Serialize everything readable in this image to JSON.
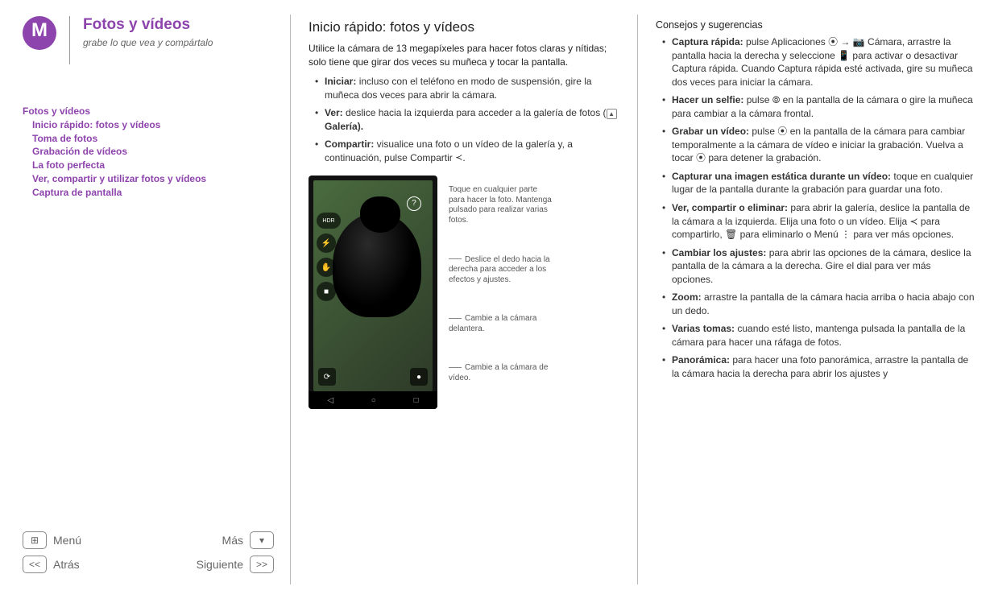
{
  "header": {
    "title": "Fotos y vídeos",
    "subtitle": "grabe lo que vea y compártalo"
  },
  "toc": {
    "root": "Fotos y vídeos",
    "items": [
      "Inicio rápido: fotos y vídeos",
      "Toma de fotos",
      "Grabación de vídeos",
      "La foto perfecta",
      "Ver, compartir y utilizar fotos y vídeos",
      "Captura de pantalla"
    ]
  },
  "nav": {
    "menu": "Menú",
    "mas": "Más",
    "atras": "Atrás",
    "siguiente": "Siguiente"
  },
  "main": {
    "title": "Inicio rápido: fotos y vídeos",
    "intro": "Utilice la cámara de 13 megapíxeles para hacer fotos claras y nítidas; solo tiene que girar dos veces su muñeca y tocar la pantalla.",
    "bullets": [
      {
        "label": "Iniciar:",
        "text": " incluso con el teléfono en modo de suspensión, gire la muñeca dos veces para abrir la cámara."
      },
      {
        "label": "Ver:",
        "text": " deslice hacia la izquierda para acceder a la galería de fotos (",
        "tail": " Galería)."
      },
      {
        "label": "Compartir:",
        "text": " visualice una foto o un vídeo de la galería y, a continuación, pulse Compartir ",
        "tail": "."
      }
    ],
    "callouts": {
      "c1": "Toque en cualquier parte para hacer la foto. Mantenga pulsado para realizar varias fotos.",
      "c2": "Deslice el dedo hacia la derecha para acceder a los efectos y ajustes.",
      "c3": "Cambie a la cámara delantera.",
      "c4": "Cambie a la cámara de vídeo."
    },
    "phone_icons": {
      "help": "?",
      "hdr": "HDR",
      "flash": "⚡",
      "touch": "✋",
      "video": "■",
      "front_cam": "⟳",
      "rec": "●",
      "back_nav": "◁",
      "home_nav": "○",
      "recent_nav": "□"
    }
  },
  "tips": {
    "title": "Consejos y sugerencias",
    "items": [
      {
        "label": "Captura rápida:",
        "text": " pulse Aplicaciones ⦿ → 📷 Cámara, arrastre la pantalla hacia la derecha y seleccione 📱 para activar o desactivar Captura rápida. Cuando Captura rápida esté activada, gire su muñeca dos veces para iniciar la cámara."
      },
      {
        "label": "Hacer un selfie:",
        "text": " pulse ⦾ en la pantalla de la cámara o gire la muñeca para cambiar a la cámara frontal."
      },
      {
        "label": "Grabar un vídeo:",
        "text": " pulse ⦿ en la pantalla de la cámara para cambiar temporalmente a la cámara de vídeo e iniciar la grabación. Vuelva a tocar ⦿ para detener la grabación."
      },
      {
        "label": "Capturar una imagen estática durante un vídeo:",
        "text": " toque en cualquier lugar de la pantalla durante la grabación para guardar una foto."
      },
      {
        "label": "Ver, compartir o eliminar:",
        "text": " para abrir la galería, deslice la pantalla de la cámara a la izquierda. Elija una foto o un vídeo. Elija ≺ para compartirlo, 🗑 para eliminarlo o Menú ⋮ para ver más opciones."
      },
      {
        "label": "Cambiar los ajustes:",
        "text": " para abrir las opciones de la cámara, deslice la pantalla de la cámara a la derecha. Gire el dial para ver más opciones."
      },
      {
        "label": "Zoom:",
        "text": " arrastre la pantalla de la cámara hacia arriba o hacia abajo con un dedo."
      },
      {
        "label": "Varias tomas:",
        "text": " cuando esté listo, mantenga pulsada la pantalla de la cámara para hacer una ráfaga de fotos."
      },
      {
        "label": "Panorámica:",
        "text": " para hacer una foto panorámica, arrastre la pantalla de la cámara hacia la derecha para abrir los ajustes y"
      }
    ]
  }
}
